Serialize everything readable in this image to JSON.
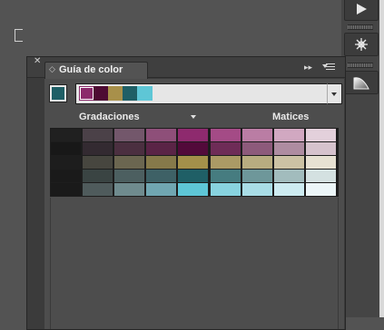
{
  "panel": {
    "title": "Guía de color",
    "base_color": "#1f5f66",
    "harmony_swatches": [
      "#8b2a6b",
      "#4e0b33",
      "#a8904a",
      "#1f5f66",
      "#5ec6d6"
    ],
    "variations_label": "Gradaciones",
    "shades_label": "Matices"
  },
  "grid_colors": [
    [
      "#202020",
      "#4b4148",
      "#73576b",
      "#8e4f79",
      "#8e2a6e",
      "#a44b86",
      "#ba7da4",
      "#d1a8c1",
      "#e3d0db"
    ],
    [
      "#181818",
      "#332a31",
      "#4b2f40",
      "#5a2446",
      "#520a3a",
      "#6e2c57",
      "#8d5a7b",
      "#ae8ca1",
      "#d6c2cd"
    ],
    [
      "#1d1d1d",
      "#47463f",
      "#6b6650",
      "#86794a",
      "#a4904a",
      "#ab9a65",
      "#b8ac80",
      "#ccc2a4",
      "#e7e1d2"
    ],
    [
      "#1a1a1a",
      "#3a4443",
      "#4c5f60",
      "#3e6166",
      "#1f5f66",
      "#467c80",
      "#6e979a",
      "#a2bcbd",
      "#d4e1e1"
    ],
    [
      "#1a1a1a",
      "#4f5b5c",
      "#6f8b8e",
      "#70a6b1",
      "#5ec6d6",
      "#88d3df",
      "#a9dde6",
      "#cdebf0",
      "#ecf6f8"
    ]
  ],
  "toolstrip": {
    "icons": [
      "play-icon",
      "gear-icon",
      "gradient-icon"
    ]
  }
}
